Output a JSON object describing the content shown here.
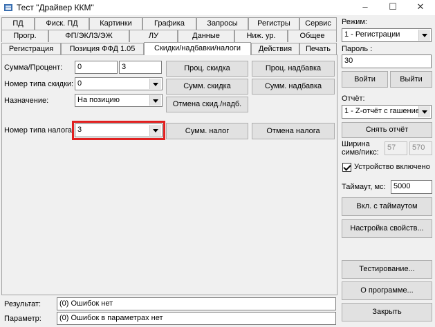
{
  "window": {
    "title": "Тест \"Драйвер ККМ\"",
    "minimize": "–",
    "maximize": "☐",
    "close": "✕"
  },
  "tabs_row1": [
    "ПД",
    "Фиск. ПД",
    "Картинки",
    "Графика",
    "Запросы",
    "Регистры",
    "Сервис"
  ],
  "tabs_row2": [
    "Прогр.",
    "ФП/ЭКЛЗ/ЭЖ",
    "ЛУ",
    "Данные",
    "Ниж. ур.",
    "Общее"
  ],
  "tabs_row3": [
    "Регистрация",
    "Позиция ФФД 1.05",
    "Скидки/надбавки/налоги",
    "Действия",
    "Печать"
  ],
  "form": {
    "sum_percent_label": "Сумма/Процент:",
    "sum_value": "0",
    "percent_value": "3",
    "discount_type_label": "Номер типа скидки:",
    "discount_type_value": "0",
    "purpose_label": "Назначение:",
    "purpose_value": "На позицию",
    "tax_type_label": "Номер типа налога:",
    "tax_type_value": "3",
    "buttons": {
      "proc_discount": "Проц. скидка",
      "proc_markup": "Проц. надбавка",
      "sum_discount": "Сумм. скидка",
      "sum_markup": "Сумм. надбавка",
      "cancel_discount": "Отмена скид./надб.",
      "sum_tax": "Сумм. налог",
      "cancel_tax": "Отмена налога"
    }
  },
  "status": {
    "result_label": "Результат:",
    "result_value": "(0) Ошибок нет",
    "param_label": "Параметр:",
    "param_value": "(0) Ошибок в параметрах нет"
  },
  "right": {
    "mode_label": "Режим:",
    "mode_value": "1 - Регистрации",
    "password_label": "Пароль :",
    "password_value": "30",
    "login": "Войти",
    "logout": "Выйти",
    "report_label": "Отчёт:",
    "report_value": "1 - Z-отчёт с гашение",
    "take_report": "Снять отчёт",
    "width_label_1": "Ширина",
    "width_label_2": "симв/пикс:",
    "width_chars": "57",
    "width_pixels": "570",
    "device_enabled": "Устройство включено",
    "timeout_label": "Таймаут, мс:",
    "timeout_value": "5000",
    "with_timeout": "Вкл. с таймаутом",
    "settings": "Настройка свойств...",
    "testing": "Тестирование...",
    "about": "О программе...",
    "close": "Закрыть"
  },
  "colors": {
    "highlight": "#e02020",
    "window_bg": "#f0f0f0"
  }
}
